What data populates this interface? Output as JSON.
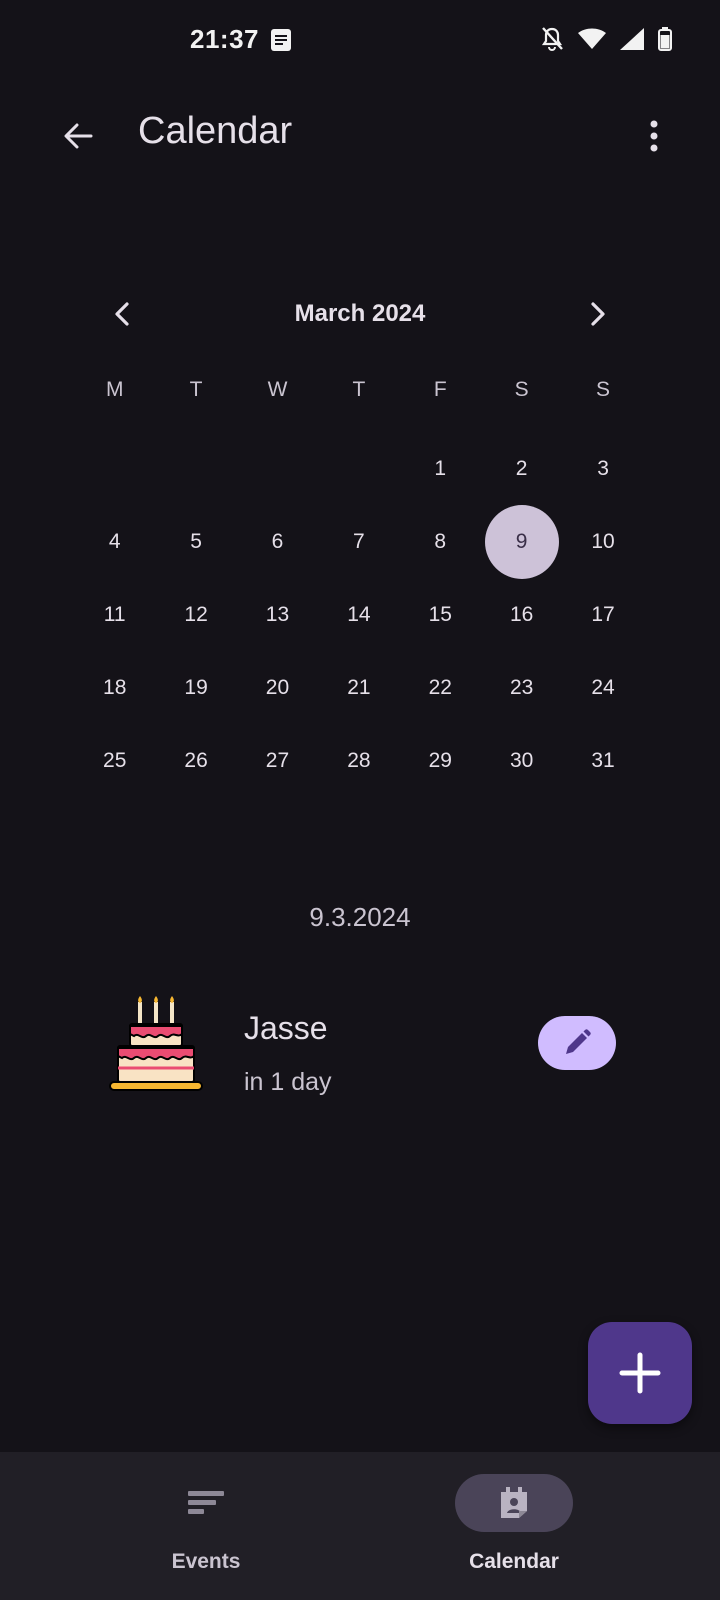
{
  "status_bar": {
    "time": "21:37",
    "icons": [
      "note-icon",
      "bell-off-icon",
      "wifi-icon",
      "signal-icon",
      "battery-icon"
    ]
  },
  "app_bar": {
    "title": "Calendar",
    "back_icon": "arrow-back-icon",
    "more_icon": "more-vert-icon"
  },
  "calendar": {
    "month_label": "March 2024",
    "weekdays": [
      "M",
      "T",
      "W",
      "T",
      "F",
      "S",
      "S"
    ],
    "leading_blanks": 4,
    "days": [
      "1",
      "2",
      "3",
      "4",
      "5",
      "6",
      "7",
      "8",
      "9",
      "10",
      "11",
      "12",
      "13",
      "14",
      "15",
      "16",
      "17",
      "18",
      "19",
      "20",
      "21",
      "22",
      "23",
      "24",
      "25",
      "26",
      "27",
      "28",
      "29",
      "30",
      "31"
    ],
    "selected_day": "9"
  },
  "selected_date_label": "9.3.2024",
  "event": {
    "name": "Jasse",
    "when": "in 1 day",
    "icon": "birthday-cake-icon",
    "edit_icon": "pencil-icon"
  },
  "fab": {
    "icon": "plus-icon"
  },
  "bottom_nav": {
    "items": [
      {
        "label": "Events",
        "icon": "events-list-icon",
        "active": false
      },
      {
        "label": "Calendar",
        "icon": "calendar-icon",
        "active": true
      }
    ]
  },
  "colors": {
    "background": "#141218",
    "selected_day": "#cdc2d8",
    "edit_button": "#d0bcff",
    "fab": "#4f378b",
    "nav_bar": "#211f26"
  }
}
